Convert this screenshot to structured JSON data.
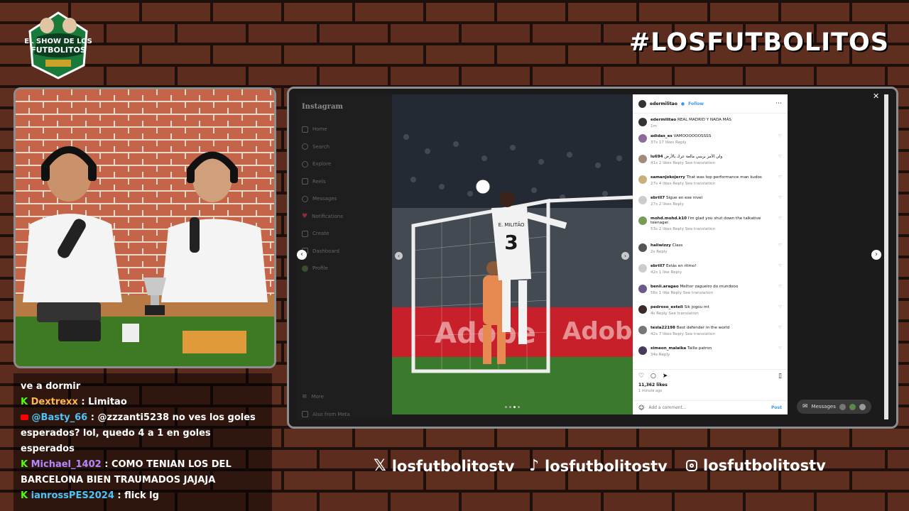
{
  "overlay": {
    "logo_text": "EL SHOW DE LOS FUTBOLITOS",
    "hashtag": "#LOSFUTBOLITOS",
    "socials": [
      {
        "icon": "x-icon",
        "handle": "losfutbolitostv"
      },
      {
        "icon": "tiktok-icon",
        "handle": "losfutbolitostv"
      },
      {
        "icon": "instagram-icon",
        "handle": "losfutbolitostv"
      }
    ]
  },
  "chat": {
    "messages": [
      {
        "text": "ve a dormir"
      },
      {
        "user": "Dextrexx",
        "text": "Limitao",
        "color": "#ffb74d"
      },
      {
        "user": "@Basty_66",
        "text": "@zzzanti5238 no ves los goles esperados? lol, quedo 4 a 1 en goles esperados",
        "color": "#4fc3f7"
      },
      {
        "user": "Michael_1402",
        "text": "COMO TENIAN LOS DEL BARCELONA BIEN TRAUMADOS JAJAJA",
        "color": "#b388ff"
      },
      {
        "user": "ianrossPES2024",
        "text": "flick lg",
        "color": "#4fc3f7"
      }
    ]
  },
  "instagram": {
    "brand": "Instagram",
    "nav": [
      "Home",
      "Search",
      "Explore",
      "Reels",
      "Messages",
      "Notifications",
      "Create",
      "Dashboard",
      "Profile"
    ],
    "more": "More",
    "also_from": "Also from Meta",
    "post_user": "edermilitao",
    "follow": "Follow",
    "caption_user": "edermilitao",
    "caption": "REAL MADRID Y NADA MÁS",
    "caption_time": "1m",
    "comments": [
      {
        "user": "adidas_es",
        "text": "VAMOOOOOOSSSS",
        "meta": "37s  17 likes  Reply"
      },
      {
        "user": "lu694",
        "text": "ولي الأمر برسي مالعة عرك بالأرض",
        "meta": "41s  2 likes  Reply  See translation"
      },
      {
        "user": "samanjokojerry",
        "text": "That was top performance man kudos",
        "meta": "27s  4 likes  Reply  See translation"
      },
      {
        "user": "ebrill7",
        "text": "Sigue en ese nivel",
        "meta": "27s  2 likes  Reply"
      },
      {
        "user": "mohd.mohd.k10",
        "text": "I'm glad you shut down the talkative teenager.",
        "meta": "53s  2 likes  Reply  See translation"
      },
      {
        "user": "haliwizzy",
        "text": "Class",
        "meta": "2s  Reply"
      },
      {
        "user": "ebrill7",
        "text": "Estás en ritmo!",
        "meta": "42s  1 like  Reply"
      },
      {
        "user": "benii.aragao",
        "text": "Melhor zagueiro do mundooo",
        "meta": "56s  1 like  Reply  See translation"
      },
      {
        "user": "pedroso_esteli",
        "text": "Sik jogou mt",
        "meta": "4s  Reply  See translation"
      },
      {
        "user": "tesla22198",
        "text": "Best defender in the world",
        "meta": "42s  7 likes  Reply  See translation"
      },
      {
        "user": "simeon_malaika",
        "text": "Taille patron",
        "meta": "34s  Reply"
      }
    ],
    "likes": "11,362 likes",
    "post_time": "1 minute ago",
    "comment_placeholder": "Add a comment...",
    "post_button": "Post",
    "messages_label": "Messages",
    "jersey_number": "3",
    "jersey_name": "E. MILITÃO",
    "ad_text": "Adobe"
  }
}
